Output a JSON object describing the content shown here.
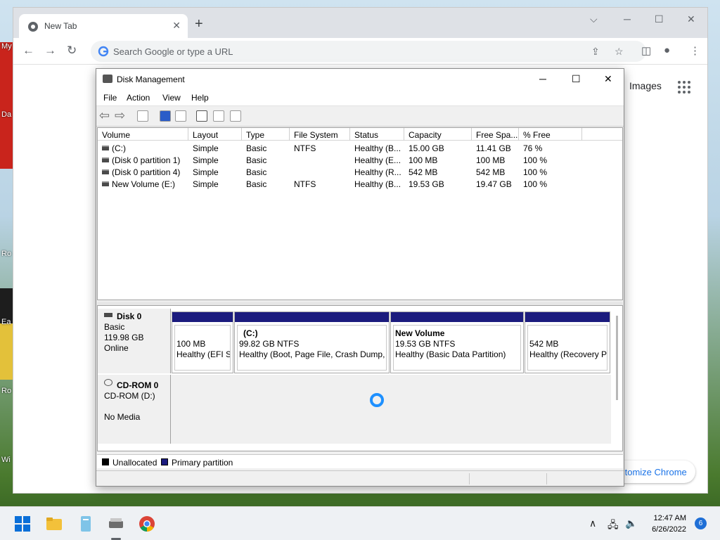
{
  "desktop": {
    "labels": [
      "My",
      "Da",
      "Ro",
      "Ea",
      "Ro",
      "Wi"
    ]
  },
  "chrome": {
    "tab_title": "New Tab",
    "new_tab": "+",
    "omnibox_placeholder": "Search Google or type a URL",
    "ntp_images": "Images",
    "customize": "Customize Chrome",
    "customize_visible": "ıtomize Chrome"
  },
  "disk_management": {
    "title": "Disk Management",
    "menu": [
      "File",
      "Action",
      "View",
      "Help"
    ],
    "columns": [
      "Volume",
      "Layout",
      "Type",
      "File System",
      "Status",
      "Capacity",
      "Free Spa...",
      "% Free"
    ],
    "volumes": [
      {
        "volume": "(C:)",
        "layout": "Simple",
        "type": "Basic",
        "fs": "NTFS",
        "status": "Healthy (B...",
        "capacity": "15.00 GB",
        "free": "11.41 GB",
        "pct": "76 %"
      },
      {
        "volume": "(Disk 0 partition 1)",
        "layout": "Simple",
        "type": "Basic",
        "fs": "",
        "status": "Healthy (E...",
        "capacity": "100 MB",
        "free": "100 MB",
        "pct": "100 %"
      },
      {
        "volume": "(Disk 0 partition 4)",
        "layout": "Simple",
        "type": "Basic",
        "fs": "",
        "status": "Healthy (R...",
        "capacity": "542 MB",
        "free": "542 MB",
        "pct": "100 %"
      },
      {
        "volume": "New Volume (E:)",
        "layout": "Simple",
        "type": "Basic",
        "fs": "NTFS",
        "status": "Healthy (B...",
        "capacity": "19.53 GB",
        "free": "19.47 GB",
        "pct": "100 %"
      }
    ],
    "disk0": {
      "name": "Disk 0",
      "type": "Basic",
      "size": "119.98 GB",
      "state": "Online",
      "partitions": [
        {
          "name": "",
          "size": "100 MB",
          "status": "Healthy (EFI S"
        },
        {
          "name": "(C:)",
          "size": "99.82 GB NTFS",
          "status": "Healthy (Boot, Page File, Crash Dump, I"
        },
        {
          "name": "New Volume",
          "size": "19.53 GB NTFS",
          "status": "Healthy (Basic Data Partition)"
        },
        {
          "name": "",
          "size": "542 MB",
          "status": "Healthy (Recovery P"
        }
      ]
    },
    "cdrom": {
      "name": "CD-ROM 0",
      "drive": "CD-ROM (D:)",
      "media": "No Media"
    },
    "legend": {
      "unallocated": "Unallocated",
      "primary": "Primary partition",
      "unallocated_color": "#000000",
      "primary_color": "#1b1b7e"
    }
  },
  "taskbar": {
    "time": "12:47 AM",
    "date": "6/26/2022",
    "notifications": "6"
  }
}
